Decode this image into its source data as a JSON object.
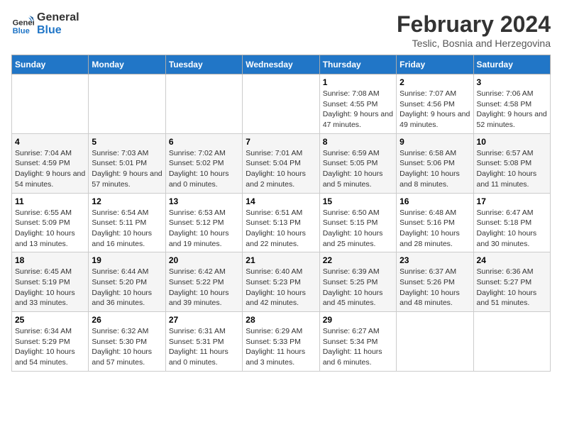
{
  "header": {
    "logo_general": "General",
    "logo_blue": "Blue",
    "month_year": "February 2024",
    "location": "Teslic, Bosnia and Herzegovina"
  },
  "days_of_week": [
    "Sunday",
    "Monday",
    "Tuesday",
    "Wednesday",
    "Thursday",
    "Friday",
    "Saturday"
  ],
  "weeks": [
    [
      {
        "day": "",
        "info": ""
      },
      {
        "day": "",
        "info": ""
      },
      {
        "day": "",
        "info": ""
      },
      {
        "day": "",
        "info": ""
      },
      {
        "day": "1",
        "info": "Sunrise: 7:08 AM\nSunset: 4:55 PM\nDaylight: 9 hours and 47 minutes."
      },
      {
        "day": "2",
        "info": "Sunrise: 7:07 AM\nSunset: 4:56 PM\nDaylight: 9 hours and 49 minutes."
      },
      {
        "day": "3",
        "info": "Sunrise: 7:06 AM\nSunset: 4:58 PM\nDaylight: 9 hours and 52 minutes."
      }
    ],
    [
      {
        "day": "4",
        "info": "Sunrise: 7:04 AM\nSunset: 4:59 PM\nDaylight: 9 hours and 54 minutes."
      },
      {
        "day": "5",
        "info": "Sunrise: 7:03 AM\nSunset: 5:01 PM\nDaylight: 9 hours and 57 minutes."
      },
      {
        "day": "6",
        "info": "Sunrise: 7:02 AM\nSunset: 5:02 PM\nDaylight: 10 hours and 0 minutes."
      },
      {
        "day": "7",
        "info": "Sunrise: 7:01 AM\nSunset: 5:04 PM\nDaylight: 10 hours and 2 minutes."
      },
      {
        "day": "8",
        "info": "Sunrise: 6:59 AM\nSunset: 5:05 PM\nDaylight: 10 hours and 5 minutes."
      },
      {
        "day": "9",
        "info": "Sunrise: 6:58 AM\nSunset: 5:06 PM\nDaylight: 10 hours and 8 minutes."
      },
      {
        "day": "10",
        "info": "Sunrise: 6:57 AM\nSunset: 5:08 PM\nDaylight: 10 hours and 11 minutes."
      }
    ],
    [
      {
        "day": "11",
        "info": "Sunrise: 6:55 AM\nSunset: 5:09 PM\nDaylight: 10 hours and 13 minutes."
      },
      {
        "day": "12",
        "info": "Sunrise: 6:54 AM\nSunset: 5:11 PM\nDaylight: 10 hours and 16 minutes."
      },
      {
        "day": "13",
        "info": "Sunrise: 6:53 AM\nSunset: 5:12 PM\nDaylight: 10 hours and 19 minutes."
      },
      {
        "day": "14",
        "info": "Sunrise: 6:51 AM\nSunset: 5:13 PM\nDaylight: 10 hours and 22 minutes."
      },
      {
        "day": "15",
        "info": "Sunrise: 6:50 AM\nSunset: 5:15 PM\nDaylight: 10 hours and 25 minutes."
      },
      {
        "day": "16",
        "info": "Sunrise: 6:48 AM\nSunset: 5:16 PM\nDaylight: 10 hours and 28 minutes."
      },
      {
        "day": "17",
        "info": "Sunrise: 6:47 AM\nSunset: 5:18 PM\nDaylight: 10 hours and 30 minutes."
      }
    ],
    [
      {
        "day": "18",
        "info": "Sunrise: 6:45 AM\nSunset: 5:19 PM\nDaylight: 10 hours and 33 minutes."
      },
      {
        "day": "19",
        "info": "Sunrise: 6:44 AM\nSunset: 5:20 PM\nDaylight: 10 hours and 36 minutes."
      },
      {
        "day": "20",
        "info": "Sunrise: 6:42 AM\nSunset: 5:22 PM\nDaylight: 10 hours and 39 minutes."
      },
      {
        "day": "21",
        "info": "Sunrise: 6:40 AM\nSunset: 5:23 PM\nDaylight: 10 hours and 42 minutes."
      },
      {
        "day": "22",
        "info": "Sunrise: 6:39 AM\nSunset: 5:25 PM\nDaylight: 10 hours and 45 minutes."
      },
      {
        "day": "23",
        "info": "Sunrise: 6:37 AM\nSunset: 5:26 PM\nDaylight: 10 hours and 48 minutes."
      },
      {
        "day": "24",
        "info": "Sunrise: 6:36 AM\nSunset: 5:27 PM\nDaylight: 10 hours and 51 minutes."
      }
    ],
    [
      {
        "day": "25",
        "info": "Sunrise: 6:34 AM\nSunset: 5:29 PM\nDaylight: 10 hours and 54 minutes."
      },
      {
        "day": "26",
        "info": "Sunrise: 6:32 AM\nSunset: 5:30 PM\nDaylight: 10 hours and 57 minutes."
      },
      {
        "day": "27",
        "info": "Sunrise: 6:31 AM\nSunset: 5:31 PM\nDaylight: 11 hours and 0 minutes."
      },
      {
        "day": "28",
        "info": "Sunrise: 6:29 AM\nSunset: 5:33 PM\nDaylight: 11 hours and 3 minutes."
      },
      {
        "day": "29",
        "info": "Sunrise: 6:27 AM\nSunset: 5:34 PM\nDaylight: 11 hours and 6 minutes."
      },
      {
        "day": "",
        "info": ""
      },
      {
        "day": "",
        "info": ""
      }
    ]
  ]
}
